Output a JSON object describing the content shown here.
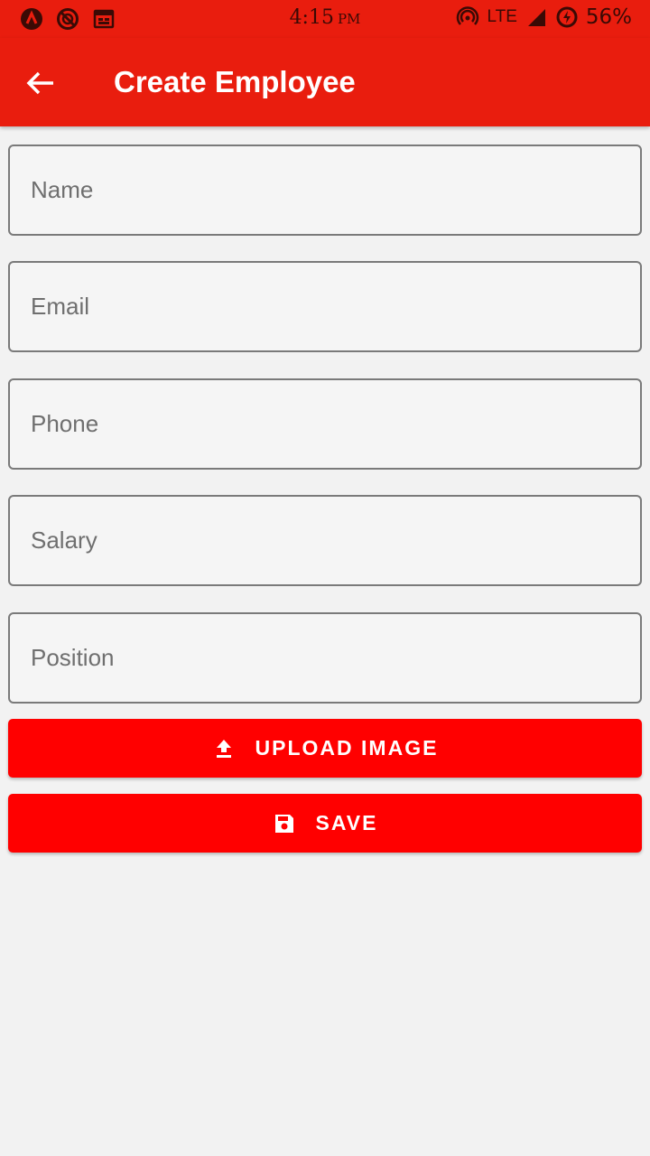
{
  "status_bar": {
    "time": "4:15",
    "ampm": "PM",
    "network": "LTE",
    "battery": "56%",
    "icons_left": [
      "app-a-icon",
      "blocked-icon",
      "calendar-icon"
    ],
    "icons_right": [
      "hotspot-icon",
      "signal-icon",
      "battery-saver-icon"
    ]
  },
  "app_bar": {
    "title": "Create Employee",
    "back_icon": "arrow-left-icon",
    "color": "#e91d0e"
  },
  "form": {
    "fields": [
      {
        "placeholder": "Name",
        "value": ""
      },
      {
        "placeholder": "Email",
        "value": ""
      },
      {
        "placeholder": "Phone",
        "value": ""
      },
      {
        "placeholder": "Salary",
        "value": ""
      },
      {
        "placeholder": "Position",
        "value": ""
      }
    ]
  },
  "buttons": {
    "upload": {
      "label": "UPLOAD IMAGE",
      "icon": "upload-icon"
    },
    "save": {
      "label": "SAVE",
      "icon": "save-icon"
    },
    "color": "#ff0000"
  }
}
